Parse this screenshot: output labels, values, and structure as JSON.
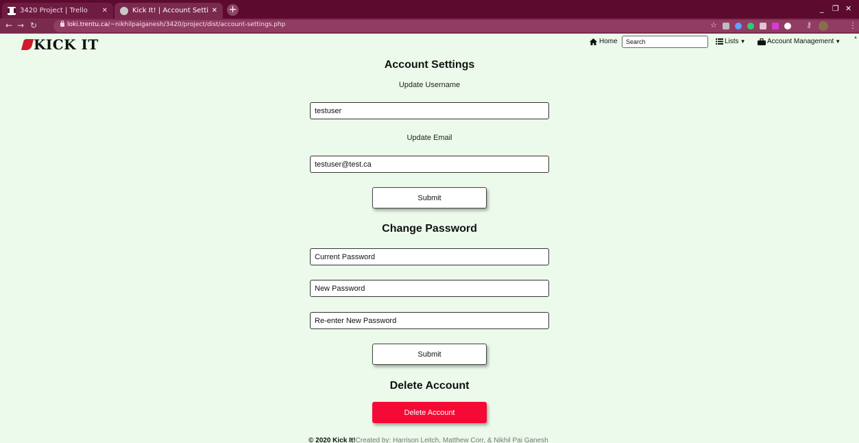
{
  "browser": {
    "tabs": [
      {
        "title": "3420 Project | Trello"
      },
      {
        "title": "Kick It! | Account Settings"
      }
    ],
    "url_host": "loki.trentu.ca",
    "url_path": "/~nikhilpaiganesh/3420/project/dist/account-settings.php"
  },
  "site": {
    "logo": "KICK IT",
    "nav": {
      "home": "Home",
      "search_placeholder": "Search",
      "lists": "Lists",
      "account": "Account Management"
    }
  },
  "page": {
    "title": "Account Settings",
    "username_label": "Update Username",
    "username_value": "testuser",
    "email_label": "Update Email",
    "email_value": "testuser@test.ca",
    "submit_label": "Submit",
    "password_heading": "Change Password",
    "current_password_placeholder": "Current Password",
    "new_password_placeholder": "New Password",
    "reenter_password_placeholder": "Re-enter New Password",
    "password_submit_label": "Submit",
    "delete_heading": "Delete Account",
    "delete_button": "Delete Account"
  },
  "footer": {
    "brand": "© 2020 Kick It!",
    "credits": "Created by: Harrison Leitch, Matthew Corr, & Nikhil Pai Ganesh"
  },
  "colors": {
    "page_bg": "#ebfaeb",
    "danger": "#f50a35",
    "chrome": "#5c0a2e"
  }
}
